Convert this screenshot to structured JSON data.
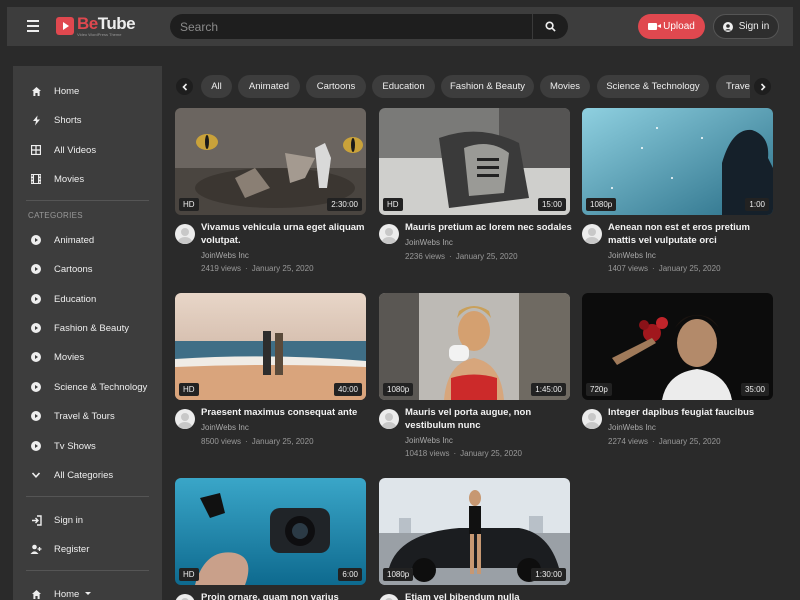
{
  "header": {
    "logo_be": "Be",
    "logo_tube": "Tube",
    "logo_tagline": "Video WordPress Theme",
    "search_placeholder": "Search",
    "upload_label": "Upload",
    "signin_label": "Sign in"
  },
  "sidebar": {
    "main_items": [
      {
        "label": "Home",
        "icon": "home-icon"
      },
      {
        "label": "Shorts",
        "icon": "bolt-icon"
      },
      {
        "label": "All Videos",
        "icon": "grid-icon"
      },
      {
        "label": "Movies",
        "icon": "film-icon"
      }
    ],
    "categories_label": "CATEGORIES",
    "categories": [
      {
        "label": "Animated"
      },
      {
        "label": "Cartoons"
      },
      {
        "label": "Education"
      },
      {
        "label": "Fashion & Beauty"
      },
      {
        "label": "Movies"
      },
      {
        "label": "Science & Technology"
      },
      {
        "label": "Travel & Tours"
      },
      {
        "label": "Tv Shows"
      }
    ],
    "all_categories_label": "All Categories",
    "signin_label": "Sign in",
    "register_label": "Register",
    "footer_home_label": "Home"
  },
  "chips": [
    "All",
    "Animated",
    "Cartoons",
    "Education",
    "Fashion & Beauty",
    "Movies",
    "Science & Technology",
    "Travel & Tours"
  ],
  "videos": [
    {
      "title": "Vivamus vehicula urna eget aliquam volutpat.",
      "channel": "JoinWebs Inc",
      "views": "2419 views",
      "date": "January 25, 2020",
      "quality": "HD",
      "duration": "2:30:00"
    },
    {
      "title": "Mauris pretium ac lorem nec sodales",
      "channel": "JoinWebs Inc",
      "views": "2236 views",
      "date": "January 25, 2020",
      "quality": "HD",
      "duration": "15:00"
    },
    {
      "title": "Aenean non est et eros pretium mattis vel vulputate orci",
      "channel": "JoinWebs Inc",
      "views": "1407 views",
      "date": "January 25, 2020",
      "quality": "1080p",
      "duration": "1:00"
    },
    {
      "title": "Praesent maximus consequat ante",
      "channel": "JoinWebs Inc",
      "views": "8500 views",
      "date": "January 25, 2020",
      "quality": "HD",
      "duration": "40:00"
    },
    {
      "title": "Mauris vel porta augue, non vestibulum nunc",
      "channel": "JoinWebs Inc",
      "views": "10418 views",
      "date": "January 25, 2020",
      "quality": "1080p",
      "duration": "1:45:00"
    },
    {
      "title": "Integer dapibus feugiat faucibus",
      "channel": "JoinWebs Inc",
      "views": "2274 views",
      "date": "January 25, 2020",
      "quality": "720p",
      "duration": "35:00"
    },
    {
      "title": "Proin ornare, quam non varius",
      "channel": "",
      "views": "",
      "date": "",
      "quality": "HD",
      "duration": "6:00"
    },
    {
      "title": "Etiam vel bibendum nulla",
      "channel": "",
      "views": "",
      "date": "",
      "quality": "1080p",
      "duration": "1:30:00"
    }
  ],
  "colors": {
    "accent": "#e0484f",
    "background": "#2a2a2a",
    "panel": "#3d3d3d"
  }
}
